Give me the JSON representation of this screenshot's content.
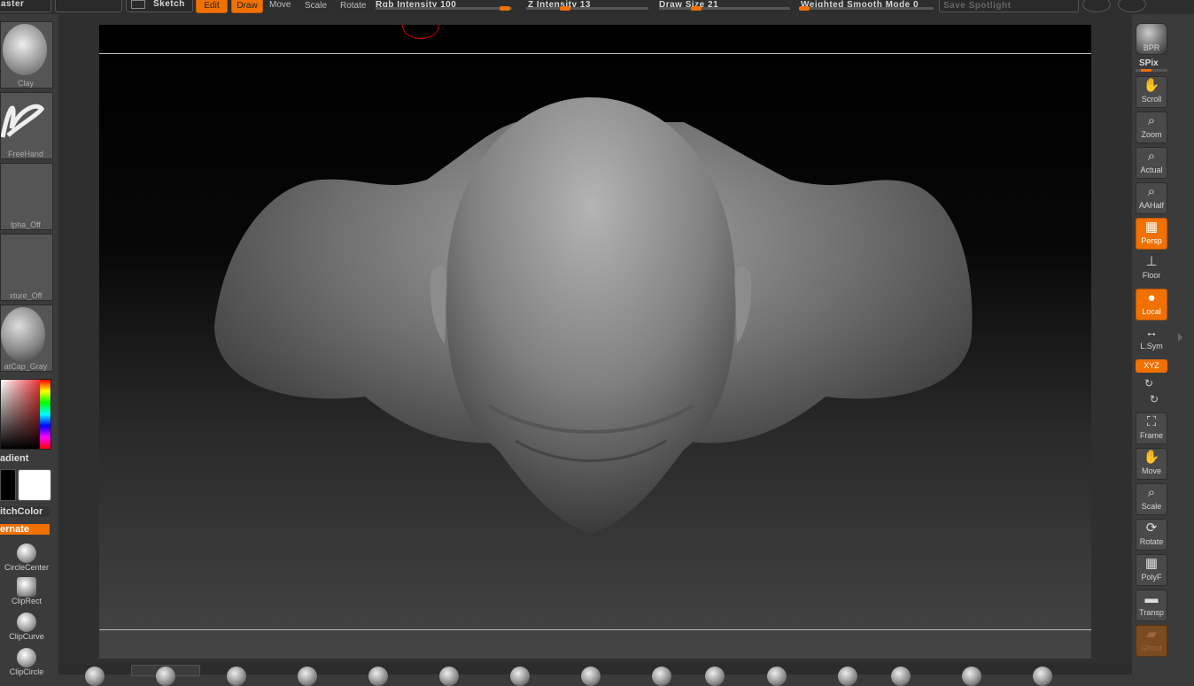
{
  "topbar": {
    "master_label": "aster",
    "sketch_label": "Sketch",
    "edit_label": "Edit",
    "draw_label": "Draw",
    "move_label": "Move",
    "scale_label": "Scale",
    "rotate_label": "Rotate",
    "rgb_intensity": "Rgb Intensity 100",
    "z_intensity": "Z Intensity 13",
    "draw_size": "Draw Size 21",
    "weighted_smooth": "Weighted Smooth Mode 0",
    "save_spotlight": "Save Spotlight"
  },
  "left": {
    "brush_label": "Clay",
    "stroke_label": "FreeHand",
    "alpha_label": "lpha_Off",
    "texture_label": "xture_Off",
    "material_label": "atCap_Gray",
    "gradient_label": "adient",
    "switchcolor_label": "itchColor",
    "alternate_label": "ernate",
    "tools": [
      {
        "label": "CircleCenter"
      },
      {
        "label": "ClipRect"
      },
      {
        "label": "ClipCurve"
      },
      {
        "label": "ClipCircle"
      }
    ]
  },
  "right": {
    "bpr_label": "BPR",
    "spix_label": "SPix",
    "buttons": [
      {
        "label": "Scroll",
        "icon": "hand-icon"
      },
      {
        "label": "Zoom",
        "icon": "zoom-icon"
      },
      {
        "label": "Actual",
        "icon": "zoom-icon"
      },
      {
        "label": "AAHalf",
        "icon": "zoom-icon"
      },
      {
        "label": "Persp",
        "icon": "grid-icon"
      },
      {
        "label": "Floor",
        "icon": "floor-icon"
      },
      {
        "label": "Local",
        "icon": "local-icon"
      },
      {
        "label": "L.Sym",
        "icon": "arrows-icon"
      },
      {
        "label": "XYZ",
        "icon": "xyz-icon"
      },
      {
        "label": "Frame",
        "icon": "frame-icon"
      },
      {
        "label": "Move",
        "icon": "hand-icon"
      },
      {
        "label": "Scale",
        "icon": "zoom-icon"
      },
      {
        "label": "Rotate",
        "icon": "rotate-icon"
      },
      {
        "label": "PolyF",
        "icon": "polyframe-icon"
      },
      {
        "label": "Transp",
        "icon": "transp-icon"
      },
      {
        "label": "Ghost",
        "icon": "ghost-icon"
      }
    ]
  },
  "colors": {
    "accent": "#f07000",
    "panel": "#3b3b3b",
    "canvas_top": "#000000",
    "canvas_bottom": "#454545"
  }
}
